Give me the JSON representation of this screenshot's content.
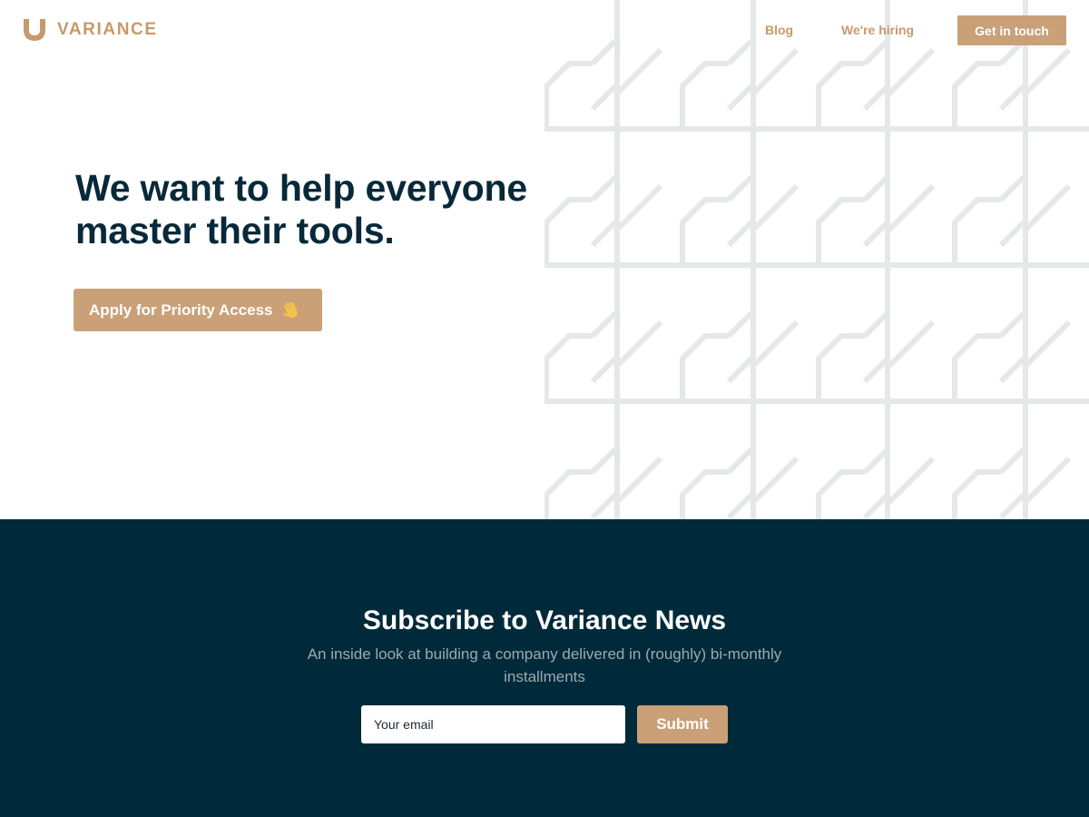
{
  "brand": {
    "name": "VARIANCE",
    "color": "#c8996a",
    "logo_icon": "variance-v-logo-icon"
  },
  "nav": {
    "links": [
      {
        "label": "Blog"
      },
      {
        "label": "We're hiring"
      }
    ],
    "cta_label": "Get in touch"
  },
  "hero": {
    "headline": "We want to help everyone master their tools.",
    "cta_label": "Apply for Priority Access",
    "cta_icon": "waving-hand-icon",
    "background_pattern": "geometric-line-pattern"
  },
  "newsletter": {
    "title": "Subscribe to Variance News",
    "subtitle": "An inside look at building a company delivered in (roughly) bi-monthly installments",
    "email_placeholder": "Your email",
    "submit_label": "Submit"
  },
  "colors": {
    "accent": "#c9a077",
    "navy": "#002a3a",
    "headline": "#082939",
    "pattern_line": "#e4e9e8"
  }
}
